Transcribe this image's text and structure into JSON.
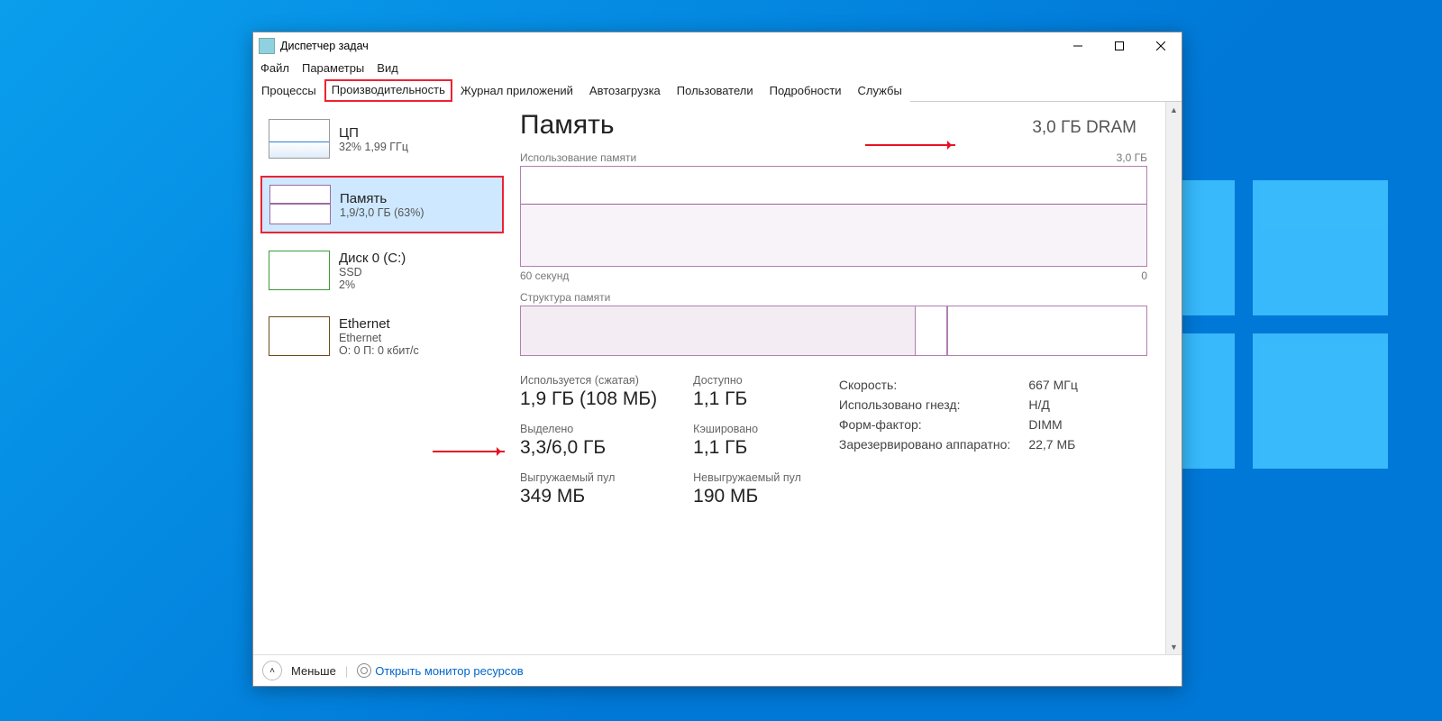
{
  "window": {
    "title": "Диспетчер задач"
  },
  "menu": {
    "file": "Файл",
    "options": "Параметры",
    "view": "Вид"
  },
  "tabs": {
    "processes": "Процессы",
    "performance": "Производительность",
    "app_history": "Журнал приложений",
    "startup": "Автозагрузка",
    "users": "Пользователи",
    "details": "Подробности",
    "services": "Службы",
    "active": "performance"
  },
  "sidebar": {
    "cpu": {
      "title": "ЦП",
      "sub": "32%  1,99 ГГц"
    },
    "mem": {
      "title": "Память",
      "sub": "1,9/3,0 ГБ (63%)"
    },
    "disk": {
      "title": "Диск 0 (C:)",
      "sub": "SSD",
      "sub2": "2%"
    },
    "net": {
      "title": "Ethernet",
      "sub": "Ethernet",
      "sub2": "О: 0 П: 0 кбит/с"
    }
  },
  "main": {
    "heading": "Память",
    "dram": "3,0 ГБ DRAM",
    "usage_label": "Использование памяти",
    "usage_max": "3,0 ГБ",
    "axis_left": "60 секунд",
    "axis_right": "0",
    "composition_label": "Структура памяти",
    "stats": {
      "in_use": {
        "label": "Используется (сжатая)",
        "value": "1,9 ГБ (108 МБ)"
      },
      "avail": {
        "label": "Доступно",
        "value": "1,1 ГБ"
      },
      "commit": {
        "label": "Выделено",
        "value": "3,3/6,0 ГБ"
      },
      "cached": {
        "label": "Кэшировано",
        "value": "1,1 ГБ"
      },
      "paged": {
        "label": "Выгружаемый пул",
        "value": "349 МБ"
      },
      "nonpaged": {
        "label": "Невыгружаемый пул",
        "value": "190 МБ"
      }
    },
    "kv": {
      "speed": {
        "k": "Скорость:",
        "v": "667 МГц"
      },
      "slots": {
        "k": "Использовано гнезд:",
        "v": "Н/Д"
      },
      "form": {
        "k": "Форм-фактор:",
        "v": "DIMM"
      },
      "reserved": {
        "k": "Зарезервировано аппаратно:",
        "v": "22,7 МБ"
      }
    }
  },
  "footer": {
    "less": "Меньше",
    "resmon": "Открыть монитор ресурсов"
  },
  "chart_data": {
    "type": "line",
    "title": "Использование памяти",
    "xlabel": "60 секунд",
    "ylabel": "",
    "ylim": [
      0,
      3.0
    ],
    "y_unit": "ГБ",
    "x_range_seconds": 60,
    "series": [
      {
        "name": "Память",
        "approx_constant_value": 1.9
      }
    ],
    "composition": {
      "total_gb": 3.0,
      "in_use_gb": 1.9,
      "compressed_mb": 108,
      "available_gb": 1.1,
      "cached_gb": 1.1,
      "committed_gb": 3.3,
      "commit_limit_gb": 6.0,
      "paged_pool_mb": 349,
      "nonpaged_pool_mb": 190,
      "hardware_reserved_mb": 22.7
    }
  }
}
